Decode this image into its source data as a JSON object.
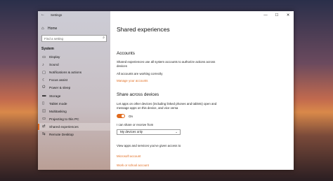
{
  "window": {
    "back_icon": "back-arrow-icon",
    "title": "Settings",
    "minimize": "—",
    "maximize": "☐",
    "close": "✕"
  },
  "sidebar": {
    "home_label": "Home",
    "search_placeholder": "Find a setting",
    "section_title": "System",
    "items": [
      {
        "label": "Display",
        "icon": "display-icon"
      },
      {
        "label": "Sound",
        "icon": "sound-icon"
      },
      {
        "label": "Notifications & actions",
        "icon": "notifications-icon"
      },
      {
        "label": "Focus assist",
        "icon": "focus-assist-icon"
      },
      {
        "label": "Power & sleep",
        "icon": "power-icon"
      },
      {
        "label": "Storage",
        "icon": "storage-icon"
      },
      {
        "label": "Tablet mode",
        "icon": "tablet-mode-icon"
      },
      {
        "label": "Multitasking",
        "icon": "multitasking-icon"
      },
      {
        "label": "Projecting to this PC",
        "icon": "projecting-icon"
      },
      {
        "label": "Shared experiences",
        "icon": "shared-experiences-icon",
        "selected": true
      },
      {
        "label": "Remote Desktop",
        "icon": "remote-desktop-icon"
      }
    ]
  },
  "main": {
    "title": "Shared experiences",
    "accounts": {
      "heading": "Accounts",
      "description": "Shared experiences use all system accounts to authorize actions across devices",
      "status": "All accounts are working correctly",
      "link": "Manage your accounts"
    },
    "share": {
      "heading": "Share across devices",
      "description": "Let apps on other devices (including linked phones and tablets) open and message apps on this device, and vice versa",
      "toggle_state": "On",
      "toggle_on": true,
      "select_label": "I can share or receive from",
      "select_value": "My devices only"
    },
    "view_text": "View apps and services you've given access to",
    "microsoft_link": "Microsoft account",
    "work_link": "Work or school account"
  },
  "colors": {
    "accent": "#e06a1d"
  }
}
